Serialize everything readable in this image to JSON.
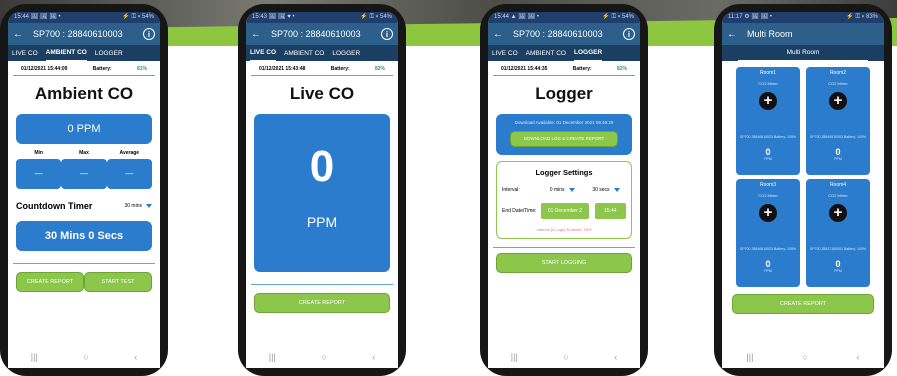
{
  "colors": {
    "app_bar": "#2c5f8a",
    "tabs": "#1b3f63",
    "accent_blue": "#2b7ccd",
    "accent_green": "#8cc64b"
  },
  "icons": {
    "back": "←",
    "info": "i",
    "nav_recents": "|||",
    "nav_home": "○",
    "nav_back": "‹",
    "dropdown": "caret-down",
    "add": "+"
  },
  "phone1": {
    "status_time": "15:44 🖼 🖼 🖼 •",
    "status_right": "⚡ ⚿ ▾ 54%",
    "title": "SP700 : 28840610003",
    "tabs": [
      "LIVE CO",
      "AMBIENT CO",
      "LOGGER"
    ],
    "datetime": "01/12/2021 15:44:09",
    "battery_label": "Battery:",
    "battery_value": "81%",
    "heading": "Ambient CO",
    "ppm": "0 PPM",
    "stat_labels": [
      "Min",
      "Max",
      "Average"
    ],
    "stat_values": [
      "—",
      "—",
      "—"
    ],
    "countdown_label": "Countdown Timer",
    "countdown_select": "30 mins",
    "timer": "30 Mins 0 Secs",
    "buttons": [
      "CREATE REPORT",
      "START TEST"
    ]
  },
  "phone2": {
    "status_time": "15:43 🖼 🖼 ♥ •",
    "status_right": "⚡ ⚿ ▾ 54%",
    "title": "SP700 : 28840610003",
    "tabs": [
      "LIVE CO",
      "AMBIENT CO",
      "LOGGER"
    ],
    "datetime": "01/12/2021 15:43:48",
    "battery_label": "Battery:",
    "battery_value": "82%",
    "heading": "Live CO",
    "value": "0",
    "unit": "PPM",
    "button": "CREATE REPORT"
  },
  "phone3": {
    "status_time": "15:44 ▲ 🖼 🖼 •",
    "status_right": "⚡ ⚿ ▾ 54%",
    "title": "SP700 : 28840610003",
    "tabs": [
      "LIVE CO",
      "AMBIENT CO",
      "LOGGER"
    ],
    "datetime": "01/12/2021 15:44:35",
    "battery_label": "Battery:",
    "battery_value": "82%",
    "heading": "Logger",
    "download_text": "Download Available: 01 December 2021 09:49:29",
    "download_button": "DOWNLOAD LOG & CREATE REPORT",
    "settings_title": "Logger Settings",
    "interval_label": "Interval:",
    "interval_mins": "0 mins",
    "interval_secs": "30 secs",
    "end_label": "End Date/Time:",
    "end_date": "01 December 2",
    "end_time": "15:44",
    "warning": "Interval (0 Logs) Enabled: 15%",
    "start_button": "START LOGGING"
  },
  "phone4": {
    "status_time": "11:17 ⚙ 🖼 🖼 •",
    "status_right": "⚡ ⚿ ▾ 83%",
    "title": "Multi Room",
    "subtitle": "Multi Room",
    "rooms": [
      {
        "name": "Room1",
        "label": "CO2 Meter",
        "id": "SP700 28840610003",
        "battery": "Battery: 100%",
        "value": "0",
        "unit": "PPM"
      },
      {
        "name": "Room2",
        "label": "CO2 Meter",
        "id": "SP700 28840610003",
        "battery": "Battery: 100%",
        "value": "0",
        "unit": "PPM"
      },
      {
        "name": "Room3",
        "label": "CO2 Meter",
        "id": "SP700 28840610003",
        "battery": "Battery: 100%",
        "value": "0",
        "unit": "PPM"
      },
      {
        "name": "Room4",
        "label": "CO2 Meter",
        "id": "SP700 28817180001",
        "battery": "Battery: 100%",
        "value": "0",
        "unit": "PPM"
      }
    ],
    "button": "CREATE REPORT"
  }
}
